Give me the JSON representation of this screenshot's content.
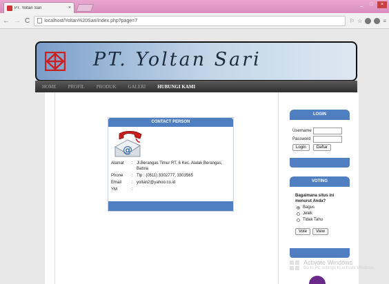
{
  "browser": {
    "tab_title": "PT. Yoltan Sari",
    "tab_close": "×",
    "window_buttons": [
      "_",
      "□",
      "×"
    ],
    "back": "←",
    "forward": "→",
    "reload": "C",
    "url": "localhost/Yoltan%20Sari/index.php?page=7"
  },
  "site": {
    "banner_text": "PT. Yoltan Sari",
    "menu": [
      {
        "label": "HOME"
      },
      {
        "label": "PROFIL"
      },
      {
        "label": "PRODUK"
      },
      {
        "label": "GALERI"
      },
      {
        "label": "HUBUNGI KAMI",
        "active": true
      }
    ],
    "accent_color": "#4f7fc1"
  },
  "contact": {
    "header": "CONTACT PERSON",
    "rows": [
      {
        "label": "Alamat",
        "sep": ":",
        "value": "Jl.Berangas Timur RT. 6 Kec. Alalak Berangas, Batola"
      },
      {
        "label": "Phone",
        "sep": ":",
        "value": "Tlp : (0511) 3302777, 3303565"
      },
      {
        "label": "Email",
        "sep": ":",
        "value": "yoltan2@yahoo.co.id"
      },
      {
        "label": "YM",
        "sep": ":",
        "value": ""
      }
    ]
  },
  "login": {
    "header": "LOGIN",
    "username_label": "Username",
    "password_label": "Password",
    "login_button": "Login",
    "register_button": "Daftar"
  },
  "voting": {
    "header": "VOTING",
    "question": "Bagaimana situs ini menurut Anda?",
    "options": [
      {
        "label": "Bagus",
        "checked": true
      },
      {
        "label": "Jelek",
        "checked": false
      },
      {
        "label": "Tidak Tahu",
        "checked": false
      }
    ],
    "vote_button": "Vote",
    "view_button": "View"
  },
  "watermark": {
    "line1": "Activate Windows",
    "line2": "Go to PC settings to activate Windows."
  }
}
